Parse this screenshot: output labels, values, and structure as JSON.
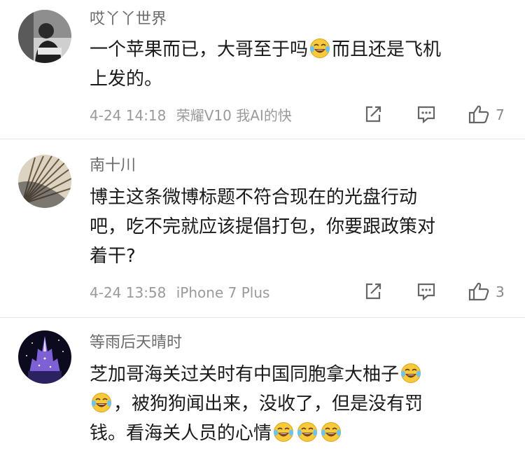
{
  "comments": [
    {
      "username": "哎丫丫世界",
      "lines": [
        {
          "text_a": "一个苹果而已，大哥至于吗",
          "emoji_count": 1,
          "text_b": "而且还是飞机"
        },
        {
          "text_a": "上发的。",
          "emoji_count": 0,
          "text_b": ""
        }
      ],
      "date": "4-24 14:18",
      "device": "荣耀V10 我AI的快",
      "likes": "7"
    },
    {
      "username": "南十川",
      "lines": [
        {
          "text_a": "博主这条微博标题不符合现在的光盘行动",
          "emoji_count": 0,
          "text_b": ""
        },
        {
          "text_a": "吧，吃不完就应该提倡打包，你要跟政策对",
          "emoji_count": 0,
          "text_b": ""
        },
        {
          "text_a": "着干?",
          "emoji_count": 0,
          "text_b": ""
        }
      ],
      "date": "4-24 13:58",
      "device": "iPhone 7 Plus",
      "likes": "3"
    },
    {
      "username": "等雨后天晴时",
      "lines": [
        {
          "text_a": "芝加哥海关过关时有中国同胞拿大柚子",
          "emoji_count": 1,
          "text_b": ""
        },
        {
          "text_a": "",
          "emoji_count": 1,
          "text_b": "，被狗狗闻出来，没收了，但是没有罚"
        },
        {
          "text_a": "钱。看海关人员的心情",
          "emoji_count": 3,
          "text_b": ""
        }
      ]
    }
  ],
  "icons": {
    "share": "share-icon",
    "comment": "comment-icon",
    "like": "thumbs-up-icon",
    "emoji": "laughing-crying-emoji"
  },
  "colors": {
    "username": "#6b6b6b",
    "meta": "#9a9a9a",
    "divider": "#e6e6e6",
    "emoji_face": "#f8c93a"
  }
}
